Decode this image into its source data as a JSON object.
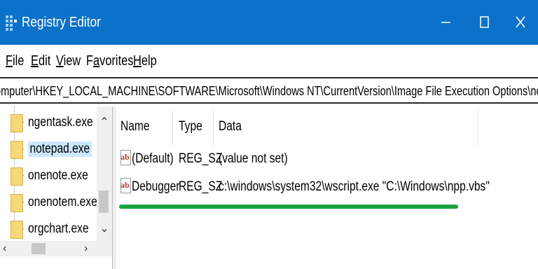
{
  "window": {
    "title": "Registry Editor",
    "controls": [
      "minimize",
      "maximize",
      "close"
    ]
  },
  "menu": {
    "items": [
      {
        "underline": "F",
        "rest": "ile"
      },
      {
        "underline": "E",
        "rest": "dit"
      },
      {
        "underline": "V",
        "rest": "iew"
      },
      {
        "underline": "",
        "pre": "F",
        "mid": "a",
        "post": "vorites"
      },
      {
        "underline": "H",
        "rest": "elp"
      }
    ]
  },
  "address": {
    "path": "omputer\\HKEY_LOCAL_MACHINE\\SOFTWARE\\Microsoft\\Windows NT\\CurrentVersion\\Image File Execution Options\\notepad.exe"
  },
  "tree": {
    "items": [
      {
        "label": "ngentask.exe",
        "selected": false
      },
      {
        "label": "notepad.exe",
        "selected": true
      },
      {
        "label": "onenote.exe",
        "selected": false
      },
      {
        "label": "onenotem.exe",
        "selected": false
      },
      {
        "label": "orgchart.exe",
        "selected": false
      }
    ]
  },
  "list": {
    "columns": [
      "Name",
      "Type",
      "Data"
    ],
    "rows": [
      {
        "icon": "string-value-icon",
        "name": "(Default)",
        "type": "REG_SZ",
        "data": "(value not set)"
      },
      {
        "icon": "string-value-icon",
        "name": "Debugger",
        "type": "REG_SZ",
        "data": "c:\\windows\\system32\\wscript.exe \"C:\\Windows\\npp.vbs\""
      }
    ]
  },
  "colors": {
    "titlebar": "#0b72c9",
    "selection": "#cce8ff",
    "highlight_underline": "#1ba140"
  }
}
